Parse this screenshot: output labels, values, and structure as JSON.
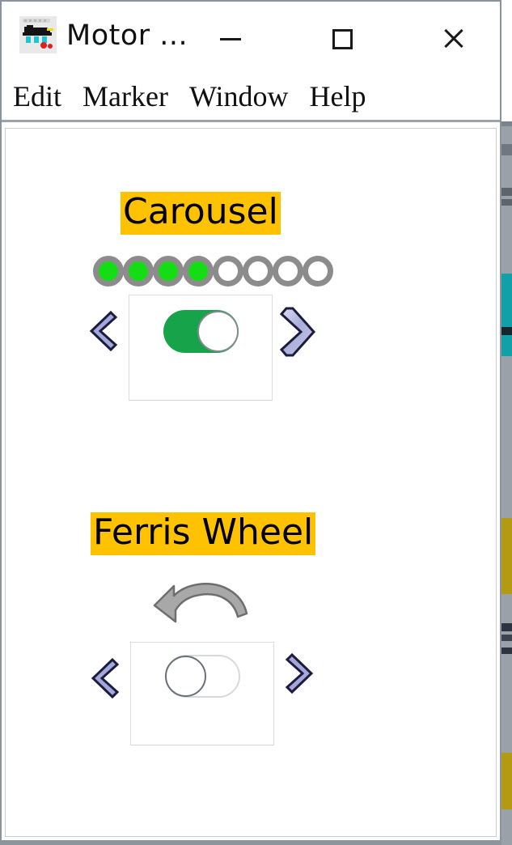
{
  "window": {
    "title": "Motor ...",
    "icon_name": "locomotive-icon",
    "controls": {
      "minimize_label": "Minimize",
      "maximize_label": "Maximize",
      "close_label": "Close"
    }
  },
  "menu": {
    "items": [
      {
        "label": "Edit"
      },
      {
        "label": "Marker"
      },
      {
        "label": "Window"
      },
      {
        "label": "Help"
      }
    ]
  },
  "colors": {
    "label_highlight": "#FFC200",
    "toggle_on": "#16A34A",
    "dot_on": "#15DD15",
    "dot_ring": "#8C8C8C",
    "chevron_fill": "#A3A8DC",
    "chevron_outline": "#1C1C3C",
    "arrow_fill": "#A8A8A8",
    "window_border": "#8B949C",
    "text": "#000000"
  },
  "rides": [
    {
      "id": "carousel",
      "name": "Carousel",
      "indicator": {
        "type": "progress-dots",
        "total": 8,
        "filled": 4,
        "states": [
          "on",
          "on",
          "on",
          "on",
          "off",
          "off",
          "off",
          "off"
        ]
      },
      "toggle": {
        "state": "on",
        "state_label": "On",
        "knob_position": "right"
      },
      "prev_label": "Previous",
      "next_label": "Next"
    },
    {
      "id": "ferriswheel",
      "name": "Ferris Wheel",
      "indicator": {
        "type": "rotation-arrow",
        "direction": "counter-clockwise"
      },
      "toggle": {
        "state": "off",
        "state_label": "Off",
        "knob_position": "left"
      },
      "prev_label": "Previous",
      "next_label": "Next"
    }
  ]
}
